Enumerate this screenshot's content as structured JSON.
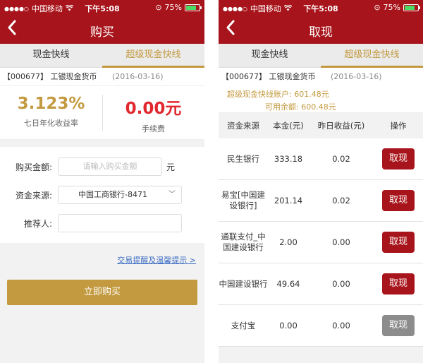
{
  "status": {
    "carrier": "中国移动",
    "time": "下午5:08",
    "battery": "75%",
    "battery_level": 0.75
  },
  "left": {
    "title": "购买",
    "tabs": [
      "现金快线",
      "超级现金快线"
    ],
    "active_tab": 1,
    "fund": {
      "code_name": "【000677】 工银现金货币",
      "date": "(2016-03-16)"
    },
    "yield": {
      "value": "3.123%",
      "label": "七日年化收益率"
    },
    "fee": {
      "value": "0.00元",
      "label": "手续费"
    },
    "form": {
      "amount_label": "购买金额:",
      "amount_placeholder": "请输入购买金额",
      "amount_unit": "元",
      "source_label": "资金来源:",
      "source_value": "中国工商银行-8471",
      "referrer_label": "推荐人:"
    },
    "tips_link": "交易提醒及温馨提示 >",
    "buy_button": "立即购买"
  },
  "right": {
    "title": "取现",
    "tabs": [
      "现金快线",
      "超级现金快线"
    ],
    "active_tab": 1,
    "fund": {
      "code_name": "【000677】 工银现金货币",
      "date": "(2016-03-16)"
    },
    "account_balance": "超级现金快线账户: 601.48元",
    "available_balance": "可用余额: 600.48元",
    "table": {
      "headers": [
        "资金来源",
        "本金(元)",
        "昨日收益(元)",
        "操作"
      ],
      "rows": [
        {
          "source": "民生银行",
          "principal": "333.18",
          "yesterday": "0.02",
          "action": "取现",
          "enabled": true
        },
        {
          "source": "易宝[中国建设银行]",
          "principal": "201.14",
          "yesterday": "0.02",
          "action": "取现",
          "enabled": true
        },
        {
          "source": "通联支付_中国建设银行",
          "principal": "2.00",
          "yesterday": "0.00",
          "action": "取现",
          "enabled": true
        },
        {
          "source": "中国建设银行",
          "principal": "49.64",
          "yesterday": "0.00",
          "action": "取现",
          "enabled": true
        },
        {
          "source": "支付宝",
          "principal": "0.00",
          "yesterday": "0.00",
          "action": "取现",
          "enabled": false
        }
      ]
    }
  },
  "colors": {
    "brand_red": "#a8141b",
    "gold": "#c39a3f",
    "fee_red": "#e0282e",
    "link_blue": "#3f6fc4",
    "disabled_gray": "#8c8c8c"
  }
}
